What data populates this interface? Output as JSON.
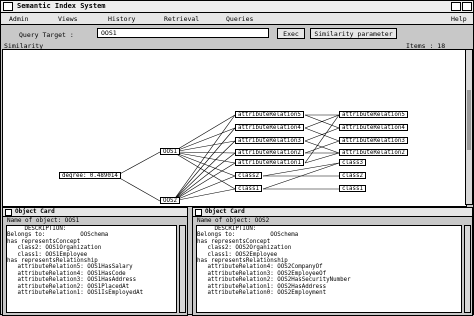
{
  "window": {
    "title": "Semantic Index System"
  },
  "menu": [
    "Admin",
    "Views",
    "History",
    "Retrieval",
    "Queries",
    "Help"
  ],
  "query": {
    "label": "Query Target :",
    "value": "OOS1",
    "exec_label": "Exec",
    "param_label": "Similarity parameter"
  },
  "similarity": {
    "label": "Similarity",
    "items_text": "Items : 18"
  },
  "graph": {
    "degree": "degree: 0.489014",
    "oos1": "OOS1",
    "oos2": "OOS2",
    "left_attrs": [
      "attributeRelation5",
      "attributeRelation4",
      "attributeRelation3",
      "attributeRelation2",
      "attributeRelation1"
    ],
    "left_classes": [
      "class2",
      "class1"
    ],
    "right_attrs": [
      "attributeRelation5",
      "attributeRelation4",
      "attributeRelation3",
      "attributeRelation2"
    ],
    "right_classes": [
      "class3",
      "class2",
      "class1"
    ]
  },
  "card1": {
    "title": "Object Card",
    "object_name": "Name of object: OOS1",
    "lines": [
      "     DESCRIPTION:",
      "",
      "Belongs to:          OOSchema",
      "",
      "has representsConcept",
      "   class2: OOS1Organization",
      "   class1: OOS1Employee",
      "",
      "has representsRelationship",
      "   attributeRelation5: OOS1HasSalary",
      "   attributeRelation4: OOS1HasCode",
      "   attributeRelation3: OOS1HasAddress",
      "   attributeRelation2: OOS1PlacedAt",
      "   attributeRelation1: OOS1IsEmployedAt"
    ]
  },
  "card2": {
    "title": "Object Card",
    "object_name": "Name of object: OOS2",
    "lines": [
      "     DESCRIPTION:",
      "",
      "Belongs to:          OOSchema",
      "",
      "has representsConcept",
      "   class2: OOS2Organization",
      "   class1: OOS2Employee",
      "",
      "has representsRelationship",
      "   attributeRelation4: OOS2CompanyOf",
      "   attributeRelation3: OOS2EmployeeOf",
      "   attributeRelation2: OOS2HasSecurityNumber",
      "   attributeRelation1: OOS2HasAddress",
      "   attributeRelation0: OOS2Employment"
    ]
  }
}
